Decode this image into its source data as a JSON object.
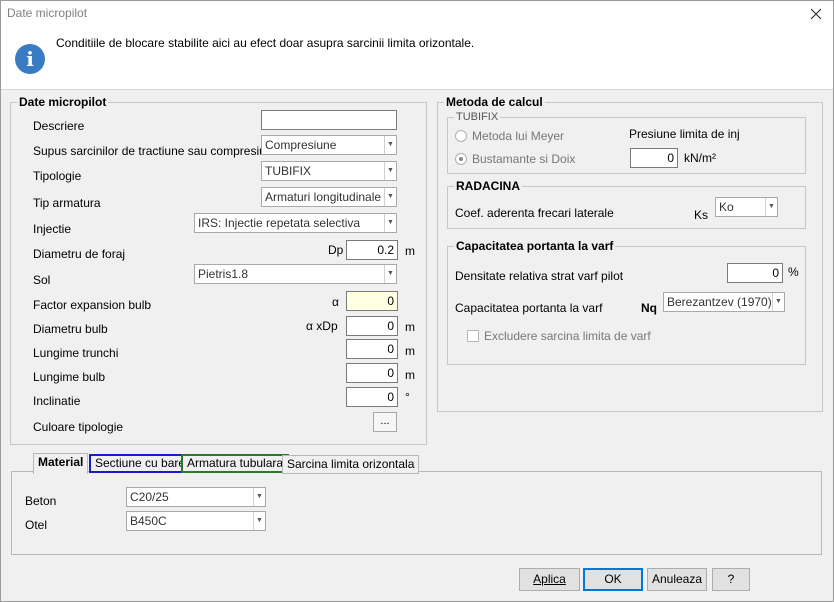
{
  "window": {
    "title": "Date micropilot"
  },
  "info": {
    "message": "Conditiile de blocare stabilite aici au efect doar asupra sarcinii limita orizontale."
  },
  "date_micropilot": {
    "legend": "Date micropilot",
    "descriere": {
      "label": "Descriere",
      "value": ""
    },
    "supus": {
      "label": "Supus sarcinilor de tractiune sau compresiune",
      "value": "Compresiune"
    },
    "tipologie": {
      "label": "Tipologie",
      "value": "TUBIFIX"
    },
    "tip_armatura": {
      "label": "Tip armatura",
      "value": "Armaturi longitudinale"
    },
    "injectie": {
      "label": "Injectie",
      "value": "IRS: Injectie repetata selectiva"
    },
    "diametru_foraj": {
      "label": "Diametru de foraj",
      "symbol": "Dp",
      "value": "0.2",
      "unit": "m"
    },
    "sol": {
      "label": "Sol",
      "value": "Pietris1.8"
    },
    "factor_expansion": {
      "label": "Factor expansion bulb",
      "symbol": "α",
      "value": "0"
    },
    "diametru_bulb": {
      "label": "Diametru bulb",
      "symbol": "α xDp",
      "value": "0",
      "unit": "m"
    },
    "lungime_trunchi": {
      "label": "Lungime trunchi",
      "value": "0",
      "unit": "m"
    },
    "lungime_bulb": {
      "label": "Lungime bulb",
      "value": "0",
      "unit": "m"
    },
    "inclinatie": {
      "label": "Inclinatie",
      "value": "0",
      "unit": "°"
    },
    "culoare": {
      "label": "Culoare tipologie",
      "button": "..."
    }
  },
  "metoda": {
    "legend": "Metoda de calcul",
    "tubifix": {
      "legend": "TUBIFIX",
      "meyer": "Metoda lui Meyer",
      "bustamante": "Bustamante si Doix",
      "presiune_label": "Presiune limita de inj",
      "presiune_value": "0",
      "presiune_unit": "kN/m²"
    },
    "radacina": {
      "legend": "RADACINA",
      "coef_label": "Coef. aderenta frecari laterale",
      "ks_symbol": "Ks",
      "ks_value": "Ko"
    },
    "capacitate": {
      "legend": "Capacitatea portanta la varf",
      "densitate_label": "Densitate relativa strat varf pilot",
      "densitate_value": "0",
      "densitate_unit": "%",
      "cap_label": "Capacitatea portanta la varf",
      "nq_symbol": "Nq",
      "nq_value": "Berezantzev (1970)",
      "excludere": "Excludere sarcina limita de varf"
    }
  },
  "tabs": {
    "items": [
      "Material",
      "Sectiune cu bare",
      "Armatura tubulara",
      "Sarcina limita orizontala"
    ],
    "beton_label": "Beton",
    "beton_value": "C20/25",
    "otel_label": "Otel",
    "otel_value": "B450C"
  },
  "buttons": {
    "aplica": "Aplica",
    "ok": "OK",
    "anuleaza": "Anuleaza",
    "help": "?"
  }
}
